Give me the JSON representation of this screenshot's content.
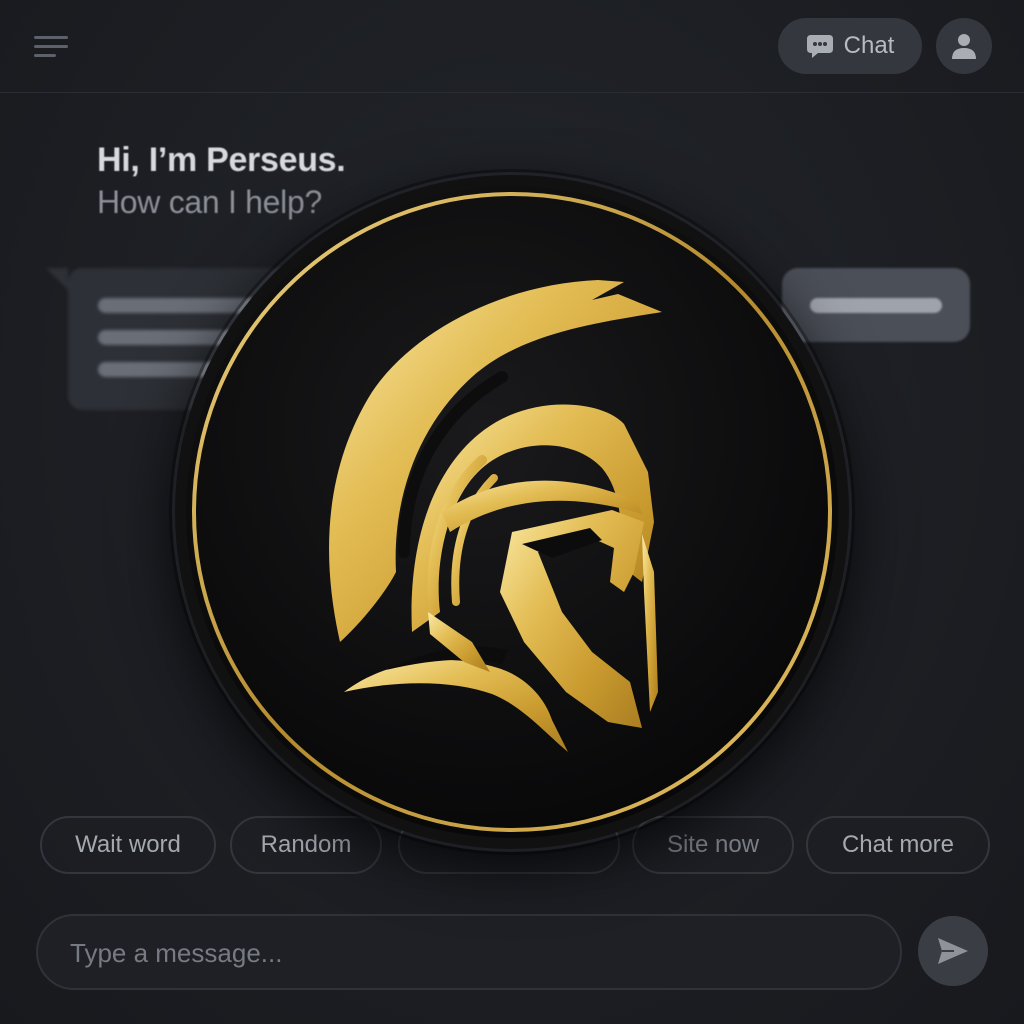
{
  "header": {
    "chat_button_label": "Chat",
    "chat_icon": "chat-bubble-icon",
    "profile_icon": "user-icon",
    "menu_icon": "menu-icon"
  },
  "greeting": {
    "title": "Hi, I’m Perseus.",
    "subtitle": "How can I help?"
  },
  "suggestions": [
    {
      "label": "Wait word"
    },
    {
      "label": "Random"
    },
    {
      "label": ""
    },
    {
      "label": "Site now"
    },
    {
      "label": "Chat more"
    }
  ],
  "composer": {
    "placeholder": "Type a message...",
    "value": "",
    "send_icon": "send-icon"
  },
  "emblem": {
    "icon": "spartan-helmet-icon",
    "colors": {
      "gold": "#d9b24a",
      "gold_light": "#f6e39a",
      "disc": "#0d0d0e"
    }
  },
  "colors": {
    "background": "#1c1e23",
    "surface": "#34373d",
    "text_primary": "#d7d9dd",
    "text_secondary": "#8d9098"
  }
}
